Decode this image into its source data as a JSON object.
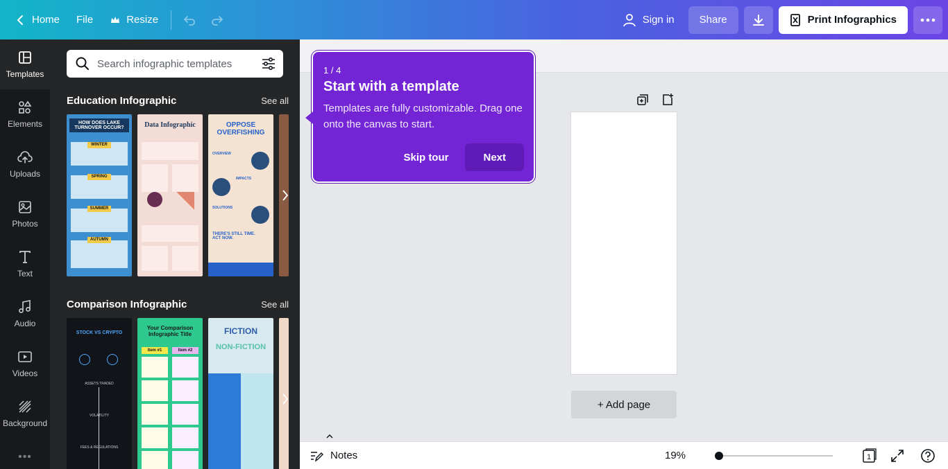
{
  "topbar": {
    "home_label": "Home",
    "file_label": "File",
    "resize_label": "Resize",
    "signin_label": "Sign in",
    "share_label": "Share",
    "print_label": "Print Infographics"
  },
  "rail": {
    "items": [
      {
        "label": "Templates",
        "icon": "templates-icon"
      },
      {
        "label": "Elements",
        "icon": "elements-icon"
      },
      {
        "label": "Uploads",
        "icon": "uploads-icon"
      },
      {
        "label": "Photos",
        "icon": "photos-icon"
      },
      {
        "label": "Text",
        "icon": "text-icon"
      },
      {
        "label": "Audio",
        "icon": "audio-icon"
      },
      {
        "label": "Videos",
        "icon": "videos-icon"
      },
      {
        "label": "Background",
        "icon": "background-icon"
      }
    ],
    "more": "•••"
  },
  "panel": {
    "search_placeholder": "Search infographic templates",
    "sections": [
      {
        "title": "Education Infographic",
        "see_all": "See all",
        "thumbs": [
          {
            "title": "HOW DOES LAKE TURNOVER OCCUR?",
            "labels": [
              "WINTER",
              "SPRING",
              "SUMMER",
              "AUTUMN"
            ],
            "bg": "#3e8fcf"
          },
          {
            "title": "Data Infographic",
            "bg": "#f3dcd6"
          },
          {
            "title": "OPPOSE OVERFISHING",
            "labels": [
              "OVERVIEW",
              "IMPACTS",
              "SOLUTIONS",
              "THERE'S STILL TIME. ACT NOW."
            ],
            "bg": "#f4e3d3"
          }
        ]
      },
      {
        "title": "Comparison Infographic",
        "see_all": "See all",
        "thumbs": [
          {
            "title": "STOCK VS CRYPTO",
            "labels": [
              "ASSETS TRADED",
              "VOLATILITY",
              "FEES & REGULATIONS"
            ],
            "bg": "#111418"
          },
          {
            "title": "Your Comparison Infographic Title",
            "labels": [
              "Item #1",
              "Item #2"
            ],
            "bg": "#2dc98e"
          },
          {
            "title": "FICTION",
            "subtitle": "NON-FICTION",
            "bg": "#d8eaf0"
          }
        ]
      }
    ]
  },
  "tour": {
    "step": "1 / 4",
    "title": "Start with a template",
    "body": "Templates are fully customizable. Drag one onto the canvas to start.",
    "skip_label": "Skip tour",
    "next_label": "Next"
  },
  "canvas": {
    "add_page_label": "+ Add page"
  },
  "bottombar": {
    "notes_label": "Notes",
    "zoom": "19%",
    "page_count": "1"
  }
}
